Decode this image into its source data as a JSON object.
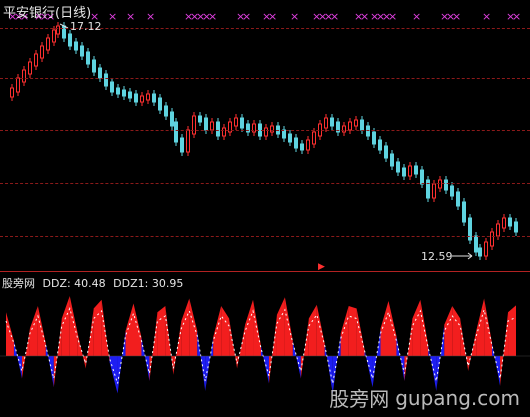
{
  "window_title": "平安银行(日线)",
  "top_marker_glyph": "×",
  "price_high_label": "17.12",
  "price_low_label": "12.59",
  "indicator_name": "股旁网",
  "ddz_label": "DDZ: 40.48",
  "ddz1_label": "DDZ1: 30.95",
  "watermark_cn": "股旁网",
  "watermark_en": "gupang.com",
  "colors": {
    "background": "#000000",
    "candle_up": "#ff3030",
    "candle_down": "#5fd4e0",
    "grid": "#8b1a1a",
    "marker": "#e040e0",
    "ddz_positive": "#ff2020",
    "ddz_negative": "#2020ff"
  },
  "chart_data": {
    "type": "line",
    "title": "平安银行(日线)",
    "series": [
      {
        "name": "DDZ",
        "values": [
          35,
          12,
          -18,
          22,
          40,
          10,
          -25,
          30,
          48,
          18,
          -10,
          38,
          45,
          -5,
          -30,
          20,
          42,
          15,
          -20,
          35,
          40,
          -15,
          28,
          46,
          20,
          -28,
          15,
          40,
          30,
          -10,
          25,
          45,
          8,
          -22,
          33,
          47,
          12,
          -18,
          30,
          41,
          10,
          -30,
          18,
          40,
          38,
          5,
          -25,
          22,
          44,
          16,
          -20,
          30,
          45,
          8,
          -28,
          25,
          40,
          30,
          -12,
          20,
          46,
          10,
          -24,
          35,
          40.48
        ]
      },
      {
        "name": "DDZ1",
        "values": [
          28,
          10,
          -12,
          18,
          32,
          8,
          -18,
          24,
          38,
          14,
          -6,
          30,
          36,
          -2,
          -22,
          16,
          34,
          12,
          -14,
          28,
          32,
          -10,
          22,
          36,
          16,
          -20,
          12,
          32,
          24,
          -6,
          20,
          36,
          6,
          -16,
          26,
          37,
          10,
          -12,
          24,
          33,
          8,
          -22,
          14,
          32,
          30,
          4,
          -18,
          18,
          35,
          12,
          -14,
          24,
          36,
          6,
          -20,
          20,
          32,
          24,
          -8,
          16,
          37,
          8,
          -18,
          28,
          30.95
        ]
      }
    ]
  }
}
